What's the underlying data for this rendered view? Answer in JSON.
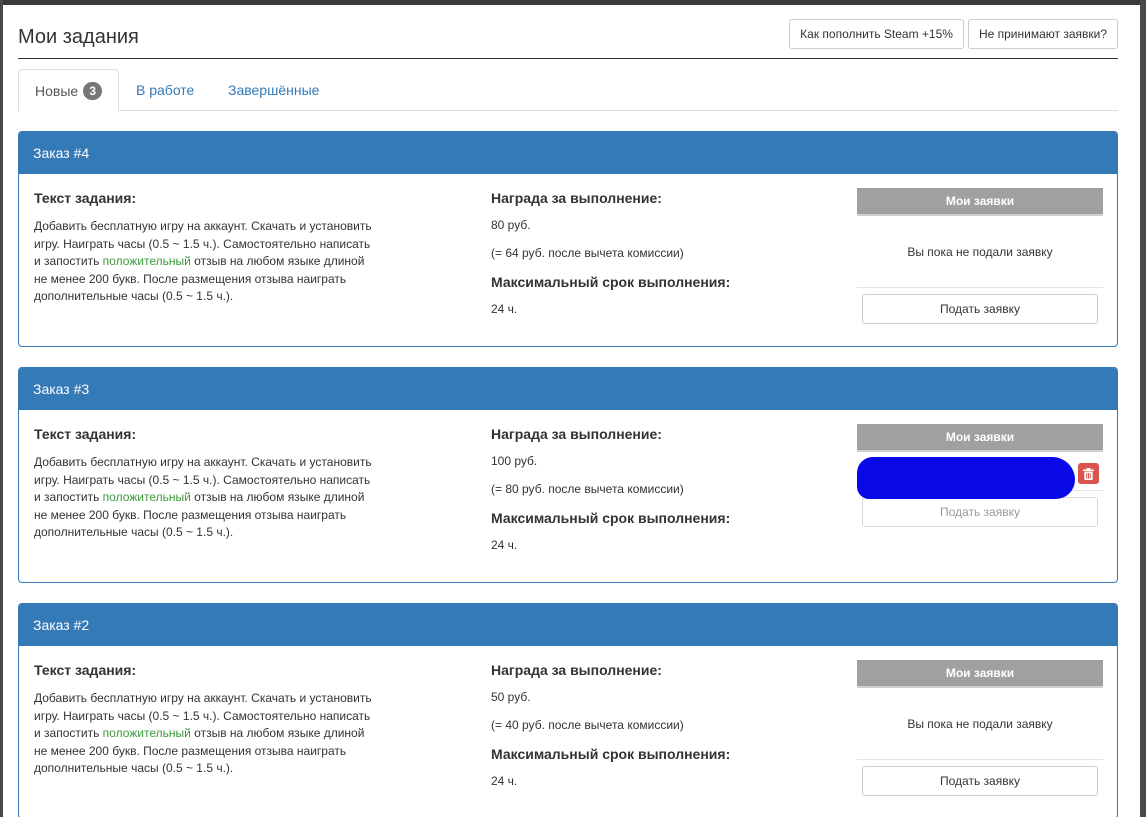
{
  "page": {
    "title": "Мои задания",
    "buttons": {
      "steam_topup": "Как пополнить Steam +15%",
      "not_accepted": "Не принимают заявки?"
    }
  },
  "tabs": [
    {
      "label": "Новые",
      "badge": "3",
      "active": true
    },
    {
      "label": "В работе",
      "active": false
    },
    {
      "label": "Завершённые",
      "active": false
    }
  ],
  "labels": {
    "task_text": "Текст задания:",
    "reward": "Награда за выполнение:",
    "deadline": "Максимальный срок выполнения:",
    "my_applications": "Мои заявки",
    "no_applications": "Вы пока не подали заявку",
    "submit": "Подать заявку"
  },
  "task_text": {
    "before": "Добавить бесплатную игру на аккаунт. Скачать и установить игру. Наиграть часы (0.5 ~ 1.5 ч.). Самостоятельно написать и запостить ",
    "highlight": "положительный",
    "after": " отзыв на любом языке длиной не менее 200 букв. После размещения отзыва наиграть дополнительные часы (0.5 ~ 1.5 ч.)."
  },
  "orders": [
    {
      "title": "Заказ #4",
      "reward": "80 руб.",
      "net": "(= 64 руб. после вычета комиссии)",
      "deadline": "24 ч."
    },
    {
      "title": "Заказ #3",
      "reward": "100 руб.",
      "net": "(= 80 руб. после вычета комиссии)",
      "deadline": "24 ч."
    },
    {
      "title": "Заказ #2",
      "reward": "50 руб.",
      "net": "(= 40 руб. после вычета комиссии)",
      "deadline": "24 ч."
    }
  ],
  "icons": {
    "delete": "trash-icon"
  },
  "colors": {
    "primary": "#337ab7",
    "badge": "#777777",
    "danger": "#d9534f",
    "highlight": "#3c9a3c",
    "apps_header": "#a0a0a0"
  }
}
